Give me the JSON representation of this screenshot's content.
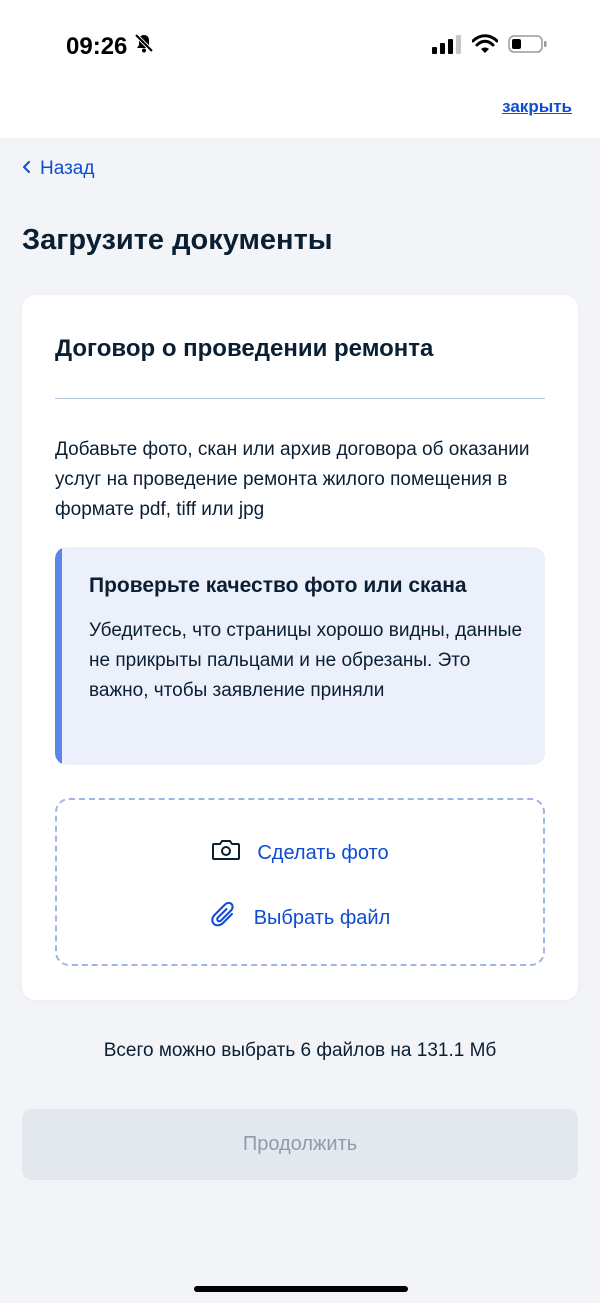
{
  "status_bar": {
    "time": "09:26",
    "icons": [
      "bell-slash-icon",
      "signal-icon",
      "wifi-icon",
      "battery-icon"
    ]
  },
  "header": {
    "close_label": "закрыть",
    "back_label": "Назад"
  },
  "page": {
    "title": "Загрузите документы"
  },
  "card": {
    "title": "Договор о проведении ремонта",
    "description": "Добавьте фото, скан или архив договора об оказании услуг на проведение ремонта жилого помещения в формате pdf, tiff или jpg",
    "notice": {
      "title": "Проверьте качество фото или скана",
      "text": "Убедитесь, что страницы хорошо видны, данные не прикрыты пальцами и не обрезаны. Это важно, чтобы заявление приняли"
    },
    "upload": {
      "photo_label": "Сделать фото",
      "file_label": "Выбрать файл"
    }
  },
  "limit_text": "Всего можно выбрать 6 файлов на 131.1 Мб",
  "continue_label": "Продолжить",
  "colors": {
    "accent": "#0d4cd3",
    "notice_bar": "#5c85e8",
    "notice_bg": "#ecf0fb",
    "page_bg": "#f2f4f8",
    "disabled_button": "#e3e8ef"
  }
}
